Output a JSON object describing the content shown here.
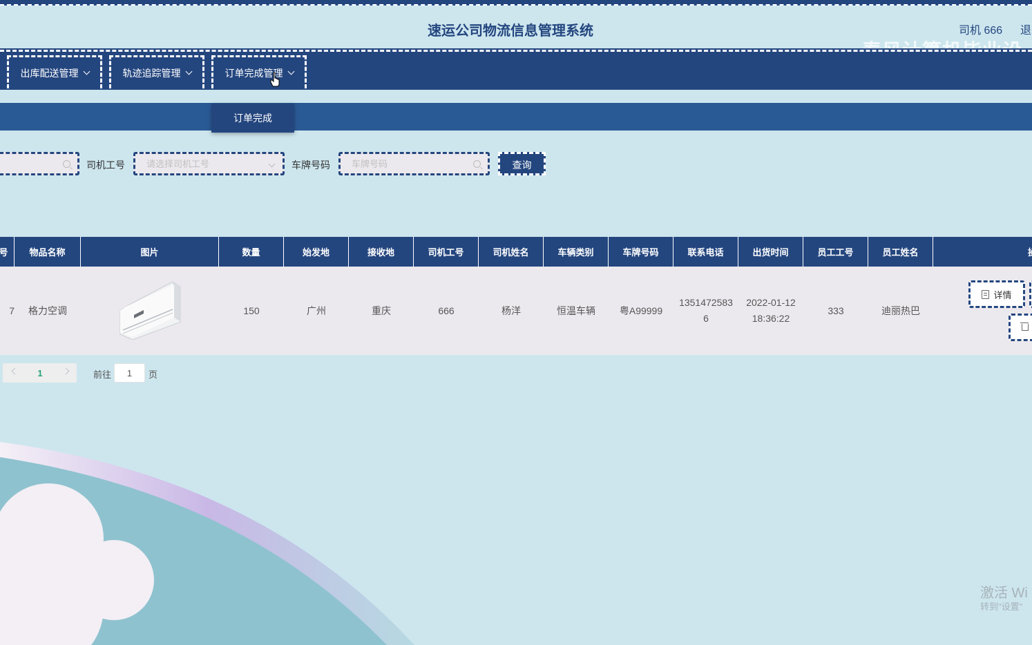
{
  "header": {
    "title": "速运公司物流信息管理系统",
    "user": "司机 666",
    "logout": "退",
    "watermark": "春风计算机毕业设"
  },
  "nav": {
    "items": [
      {
        "label": "出库配送管理"
      },
      {
        "label": "轨迹追踪管理"
      },
      {
        "label": "订单完成管理"
      }
    ],
    "dropdown_item": "订单完成"
  },
  "search": {
    "first_placeholder": "",
    "driver_id_label": "司机工号",
    "driver_id_placeholder": "请选择司机工号",
    "plate_label": "车牌号码",
    "plate_placeholder": "车牌号码",
    "query_button": "查询"
  },
  "table": {
    "columns": [
      "号",
      "物品名称",
      "图片",
      "数量",
      "始发地",
      "接收地",
      "司机工号",
      "司机姓名",
      "车辆类别",
      "车牌号码",
      "联系电话",
      "出货时间",
      "员工工号",
      "员工姓名",
      "操"
    ],
    "rows": [
      {
        "index": "7",
        "item_name": "格力空调",
        "image": "air-conditioner",
        "quantity": "150",
        "origin": "广州",
        "destination": "重庆",
        "driver_id": "666",
        "driver_name": "杨洋",
        "vehicle_type": "恒温车辆",
        "plate": "粤A99999",
        "phone": "13514725836",
        "ship_time": "2022-01-12 18:36:22",
        "staff_id": "333",
        "staff_name": "迪丽热巴",
        "detail_button": "详情"
      }
    ]
  },
  "pagination": {
    "current_page": "1",
    "goto_label": "前往",
    "goto_value": "1",
    "page_unit": "页"
  },
  "os_overlay": {
    "activate": "激活 Wi",
    "activate_sub": "转到\"设置\""
  },
  "colors": {
    "primary": "#24467f",
    "band": "#2a5a96",
    "background": "#cde6ee",
    "row": "#ece9ee",
    "page_active": "#24a374"
  }
}
